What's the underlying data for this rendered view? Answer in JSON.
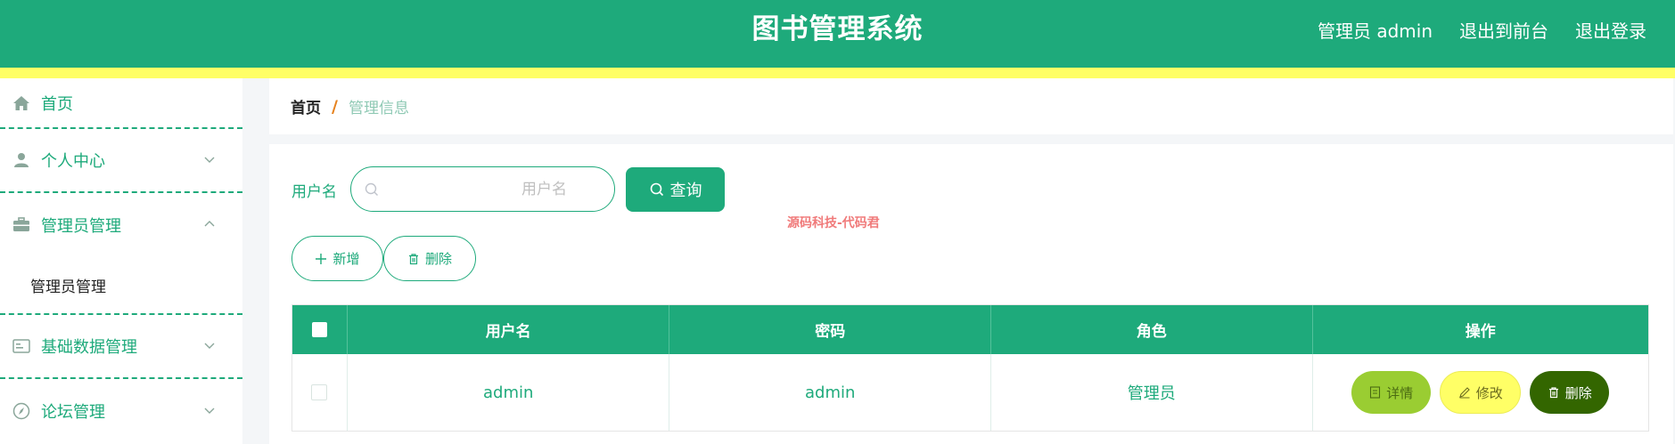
{
  "header": {
    "title": "图书管理系统",
    "user_label": "管理员 admin",
    "to_front_label": "退出到前台",
    "logout_label": "退出登录"
  },
  "sidebar": {
    "items": [
      {
        "label": "首页",
        "icon": "home-icon"
      },
      {
        "label": "个人中心",
        "icon": "user-icon"
      },
      {
        "label": "管理员管理",
        "icon": "briefcase-icon"
      },
      {
        "label": "基础数据管理",
        "icon": "id-card-icon"
      },
      {
        "label": "论坛管理",
        "icon": "compass-icon"
      }
    ],
    "submenu": {
      "label": "管理员管理"
    }
  },
  "breadcrumb": {
    "home": "首页",
    "separator": "/",
    "current": "管理信息"
  },
  "search": {
    "label": "用户名",
    "placeholder": "用户名",
    "button_label": "查询"
  },
  "watermark": "源码科技-代码君",
  "actions": {
    "add_label": "新增",
    "delete_label": "删除"
  },
  "table": {
    "columns": [
      "用户名",
      "密码",
      "角色",
      "操作"
    ],
    "rows": [
      {
        "username": "admin",
        "password": "admin",
        "role": "管理员"
      }
    ],
    "row_actions": {
      "detail": "详情",
      "edit": "修改",
      "delete": "删除"
    }
  },
  "colors": {
    "primary": "#1eaa7b",
    "stripe": "#ffff66",
    "detail": "#9acd32",
    "edit": "#ffff66",
    "delete": "#336600"
  }
}
